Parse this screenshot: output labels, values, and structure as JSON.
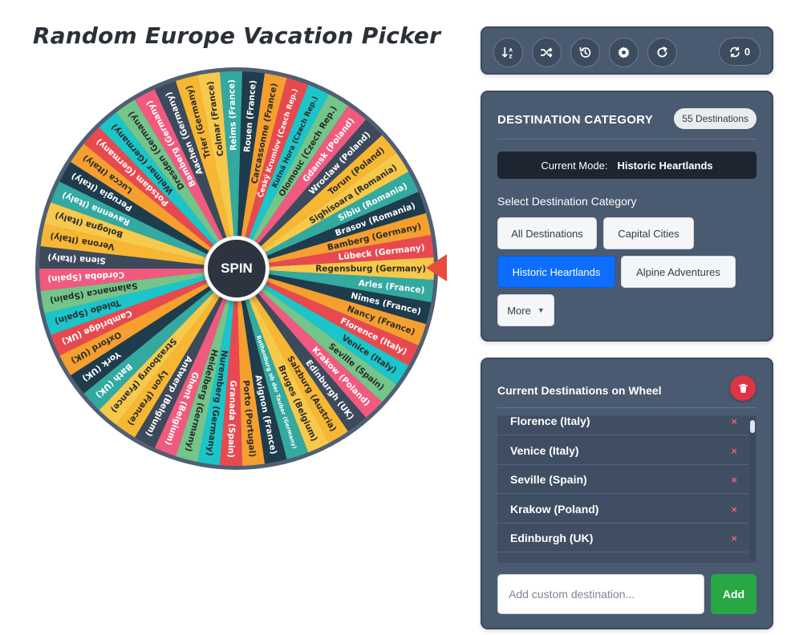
{
  "page": {
    "title": "Random Europe Vacation Picker"
  },
  "wheel": {
    "spin_label": "SPIN",
    "colors": [
      "#f7c94b",
      "#33a9a0",
      "#1f3c4c",
      "#f59f2f",
      "#e8494f",
      "#1bc5c9",
      "#73c58a",
      "#f05a7e",
      "#3c4a5c",
      "#f7b733"
    ],
    "segments": [
      "Regensburg (Germany)",
      "Arles (France)",
      "Nîmes (France)",
      "Nancy (France)",
      "Florence (Italy)",
      "Venice (Italy)",
      "Seville (Spain)",
      "Krakow (Poland)",
      "Edinburgh (UK)",
      "Salzburg (Austria)",
      "Bruges (Belgium)",
      "Rothenburg ob der Tauber (Germany)",
      "Avignon (France)",
      "Porto (Portugal)",
      "Granada (Spain)",
      "Nuremberg (Germany)",
      "Heidelberg (Germany)",
      "Ghent (Belgium)",
      "Antwerp (Belgium)",
      "Lyon (France)",
      "Strasbourg (France)",
      "Bath (UK)",
      "York (UK)",
      "Oxford (UK)",
      "Cambridge (UK)",
      "Toledo (Spain)",
      "Salamanca (Spain)",
      "Córdoba (Spain)",
      "Siena (Italy)",
      "Verona (Italy)",
      "Bologna (Italy)",
      "Ravenna (Italy)",
      "Perugia (Italy)",
      "Lucca (Italy)",
      "Potsdam (Germany)",
      "Weimar (Germany)",
      "Dresden (Germany)",
      "Bamberg (Germany)",
      "Aachen (Germany)",
      "Trier (Germany)",
      "Colmar (France)",
      "Reims (France)",
      "Rouen (France)",
      "Carcassonne (France)",
      "Český Krumlov (Czech Rep.)",
      "Kutná Hora (Czech Rep.)",
      "Olomouc (Czech Rep.)",
      "Gdansk (Poland)",
      "Wroclaw (Poland)",
      "Torun (Poland)",
      "Sighisoara (Romania)",
      "Sibiu (Romania)",
      "Brasov (Romania)",
      "Bamberg (Germany)",
      "Lübeck (Germany)"
    ]
  },
  "toolbar": {
    "counter_value": "0",
    "buttons": [
      "sort-icon",
      "shuffle-icon",
      "history-icon",
      "gear-icon",
      "refresh-icon"
    ]
  },
  "category": {
    "title": "DESTINATION CATEGORY",
    "count_badge": "55 Destinations",
    "mode_label": "Current Mode:",
    "mode_value": "Historic Heartlands",
    "select_label": "Select Destination Category",
    "buttons": {
      "all": "All Destinations",
      "capital": "Capital Cities",
      "historic": "Historic Heartlands",
      "alpine": "Alpine Adventures",
      "more": "More"
    },
    "active": "Historic Heartlands"
  },
  "current": {
    "title": "Current Destinations on Wheel",
    "items": [
      "Florence (Italy)",
      "Venice (Italy)",
      "Seville (Spain)",
      "Krakow (Poland)",
      "Edinburgh (UK)"
    ],
    "remove_glyph": "×",
    "input_placeholder": "Add custom destination...",
    "add_label": "Add"
  }
}
